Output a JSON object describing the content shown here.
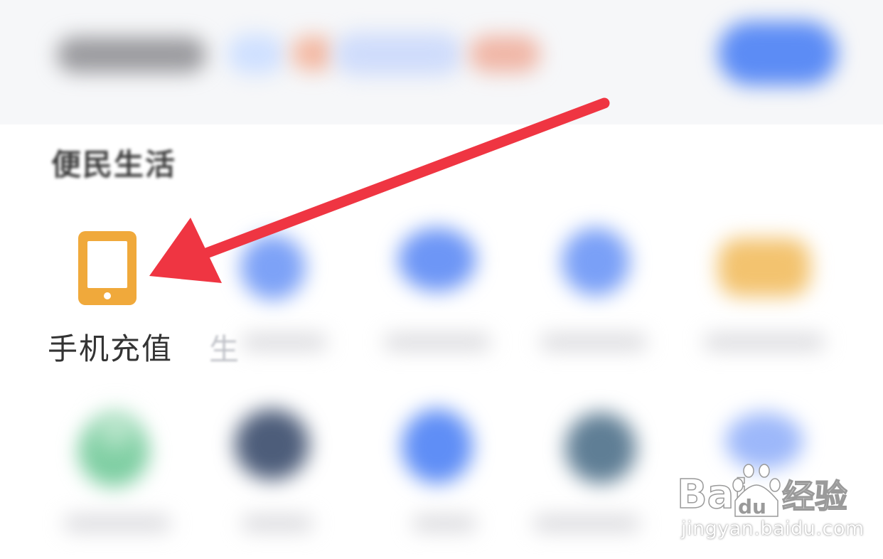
{
  "section": {
    "title": "便民生活"
  },
  "featured_item": {
    "label": "手机充值",
    "icon": "mobile-phone-icon",
    "icon_color": "#f0a93b"
  },
  "partial_item": {
    "label_fragment": "生"
  },
  "annotation": {
    "arrow_color": "#ef3542"
  },
  "watermark": {
    "logo_text_en": "Bai",
    "logo_text_du": "du",
    "logo_text_cn": "经验",
    "url": "jingyan.baidu.com"
  },
  "colors": {
    "accent_blue": "#5c8cf5",
    "icon_orange": "#f0a93b",
    "icon_green": "#6cc79a",
    "icon_dark": "#4d5d7a"
  }
}
